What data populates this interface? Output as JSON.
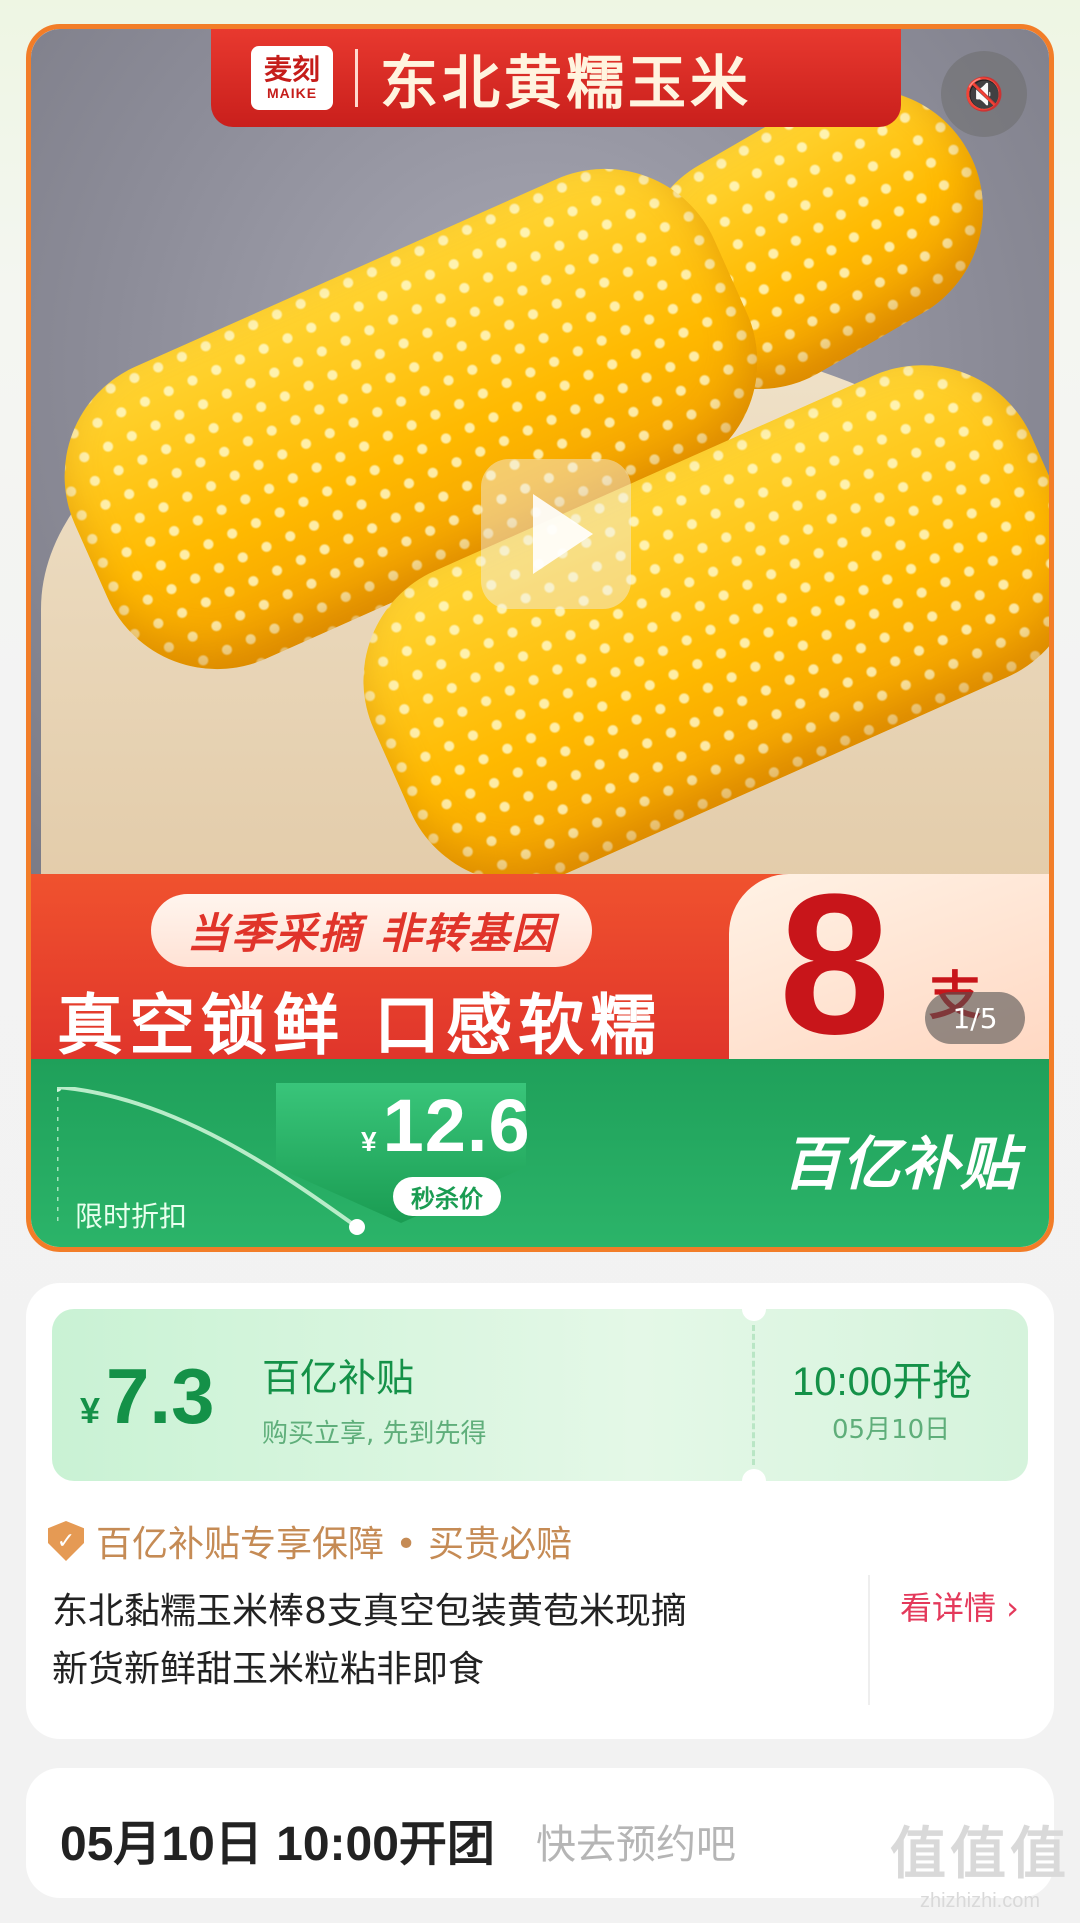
{
  "media": {
    "brand_logo_cn": "麦刻",
    "brand_logo_en": "MAIKE",
    "brand_title": "东北黄糯玉米",
    "mute_icon": "speaker-mute-icon",
    "play_icon": "play-icon",
    "promo_pill": "当季采摘 非转基因",
    "promo_main": "真空锁鲜 口感软糯",
    "count_num": "8",
    "count_unit": "支",
    "page_indicator": "1/5"
  },
  "price_band": {
    "limited_label": "限时折扣",
    "currency": "¥",
    "flash_price": "12.6",
    "flash_tag": "秒杀价",
    "subsidy_logo": "百亿补贴"
  },
  "coupon": {
    "currency": "¥",
    "price": "7.3",
    "title": "百亿补贴",
    "subtitle": "购买立享, 先到先得",
    "start_time": "10:00开抢",
    "start_date": "05月10日"
  },
  "product": {
    "guarantee": "百亿补贴专享保障 • 买贵必赔",
    "title": "东北黏糯玉米棒8支真空包装黄苞米现摘新货新鲜甜玉米粒粘非即食",
    "detail_link": "看详情 ›"
  },
  "group_open": {
    "time": "05月10日 10:00开团",
    "hint": "快去预约吧"
  },
  "watermark": {
    "mark": "值值值",
    "url": "zhizhizhi.com"
  },
  "colors": {
    "accent_red": "#e0352b",
    "accent_green": "#1fa05a",
    "coupon_green": "#149148",
    "link_pink": "#e4395b"
  }
}
